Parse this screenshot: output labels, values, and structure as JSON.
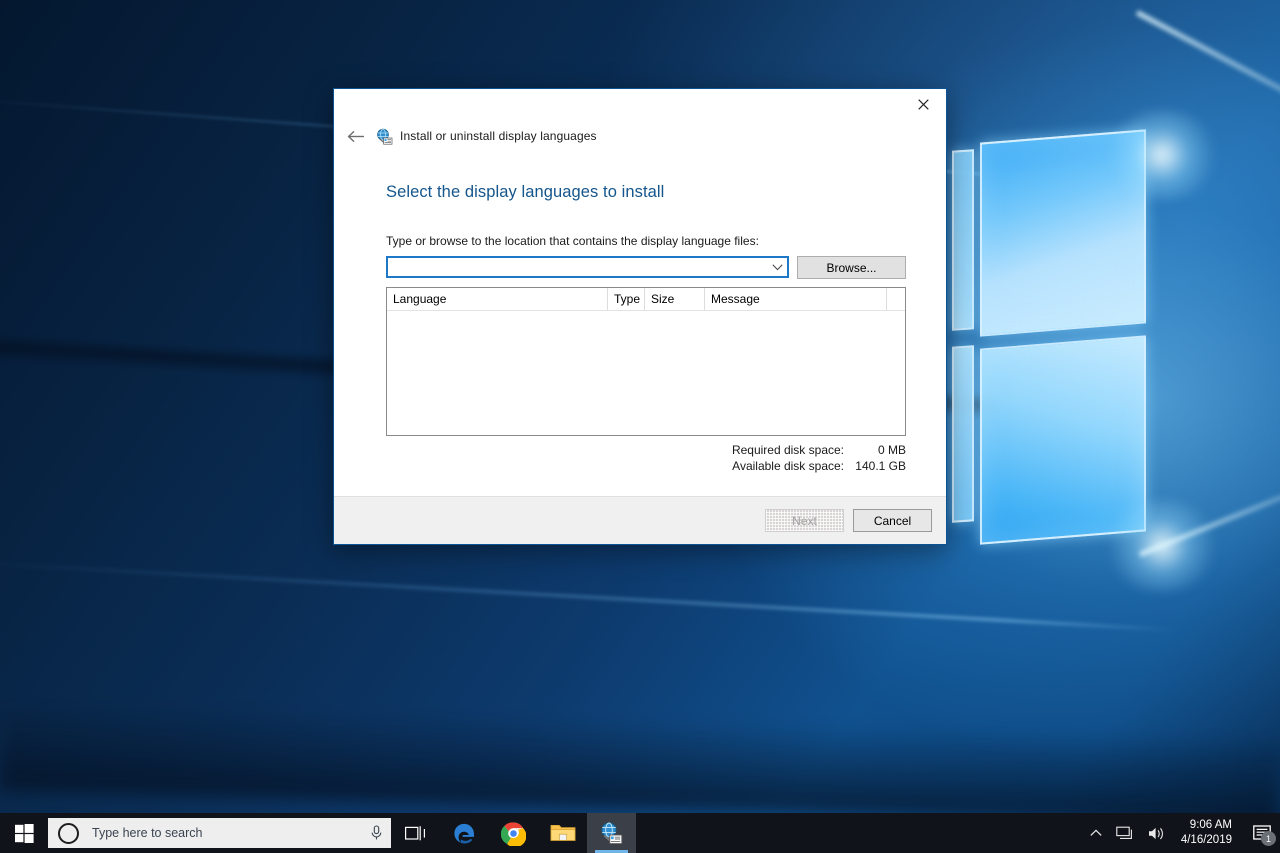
{
  "dialog": {
    "nav_title": "Install or uninstall display languages",
    "nav_icon": "globe-language-icon",
    "back_icon": "back-arrow-icon",
    "close_icon": "close-icon",
    "heading": "Select the display languages to install",
    "field_label": "Type or browse to the location that contains the display language files:",
    "path_value": "",
    "path_placeholder": "",
    "combo_arrow_icon": "chevron-down-icon",
    "browse_label": "Browse...",
    "list": {
      "columns": [
        "Language",
        "Type",
        "Size",
        "Message",
        ""
      ],
      "rows": []
    },
    "disk": {
      "required_label": "Required disk space:",
      "required_value": "0 MB",
      "available_label": "Available disk space:",
      "available_value": "140.1 GB"
    },
    "footer": {
      "next_label": "Next",
      "cancel_label": "Cancel"
    },
    "accent_color": "#14558c",
    "focus_border_color": "#1e78c8"
  },
  "taskbar": {
    "start_icon": "windows-start-icon",
    "search": {
      "cortana_icon": "cortana-circle-icon",
      "placeholder": "Type here to search",
      "mic_icon": "microphone-icon"
    },
    "items": [
      {
        "name": "task-view-icon",
        "label": "Task View"
      },
      {
        "name": "edge-icon",
        "label": "Microsoft Edge"
      },
      {
        "name": "chrome-icon",
        "label": "Google Chrome"
      },
      {
        "name": "file-explorer-icon",
        "label": "File Explorer"
      },
      {
        "name": "language-settings-icon",
        "label": "Install or uninstall display languages"
      }
    ],
    "tray": {
      "chevron_icon": "show-hidden-icons-chevron",
      "network_icon": "network-icon",
      "volume_icon": "volume-icon",
      "time": "9:06 AM",
      "date": "4/16/2019",
      "action_center_icon": "action-center-icon",
      "notification_count": "1"
    }
  }
}
